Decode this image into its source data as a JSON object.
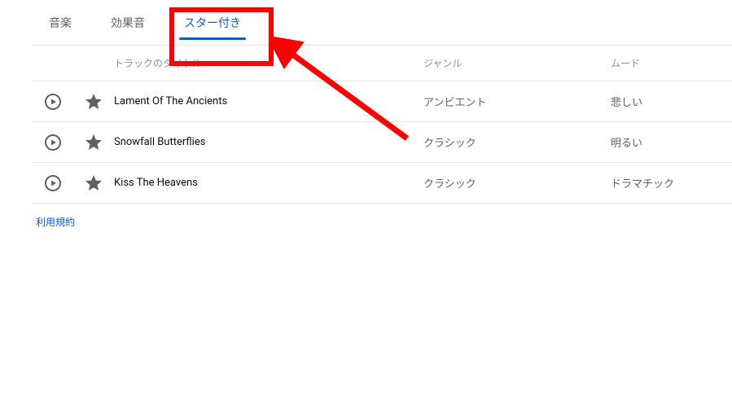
{
  "tabs": {
    "music": "音楽",
    "sfx": "効果音",
    "starred": "スター付き"
  },
  "headers": {
    "title": "トラックのタイトル",
    "genre": "ジャンル",
    "mood": "ムード"
  },
  "tracks": [
    {
      "title": "Lament Of The Ancients",
      "genre": "アンビエント",
      "mood": "悲しい"
    },
    {
      "title": "Snowfall Butterflies",
      "genre": "クラシック",
      "mood": "明るい"
    },
    {
      "title": "Kiss The Heavens",
      "genre": "クラシック",
      "mood": "ドラマチック"
    }
  ],
  "terms": "利用規約"
}
